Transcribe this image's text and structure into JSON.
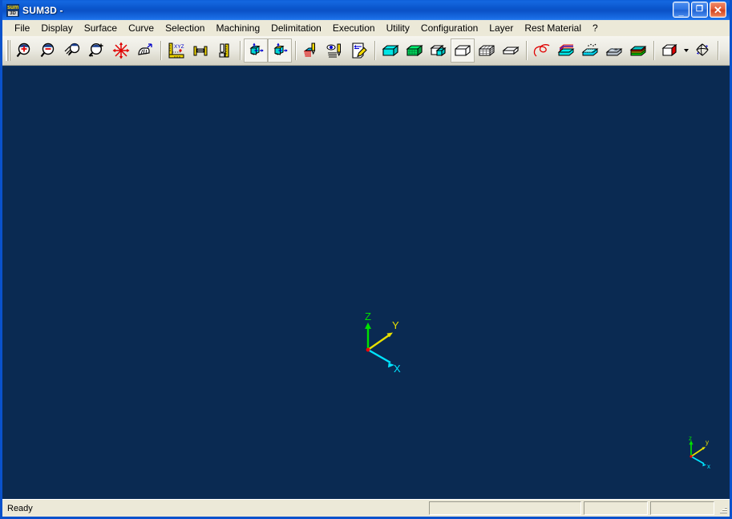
{
  "window": {
    "title": "SUM3D  -",
    "app_icon_top": "sum",
    "app_icon_bottom": "3D",
    "icon_name": "sum3d-app-icon",
    "minimize_glyph": "_",
    "maximize_glyph": "❐",
    "close_glyph": "✕"
  },
  "menu": {
    "items": [
      {
        "label": "File"
      },
      {
        "label": "Display"
      },
      {
        "label": "Surface"
      },
      {
        "label": "Curve"
      },
      {
        "label": "Selection"
      },
      {
        "label": "Machining"
      },
      {
        "label": "Delimitation"
      },
      {
        "label": "Execution"
      },
      {
        "label": "Utility"
      },
      {
        "label": "Configuration"
      },
      {
        "label": "Layer"
      },
      {
        "label": "Rest Material"
      },
      {
        "label": "?"
      }
    ]
  },
  "toolbar": {
    "buttons": [
      {
        "name": "zoom-in-icon",
        "kind": "sep-before"
      },
      {
        "name": "zoom-out-icon"
      },
      {
        "name": "zoom-dynamic-icon"
      },
      {
        "name": "zoom-window-icon"
      },
      {
        "name": "zoom-all-icon"
      },
      {
        "name": "pan-icon"
      },
      {
        "name": "measure-xyz-icon"
      },
      {
        "name": "measure-distance-icon"
      },
      {
        "name": "measure-tool-icon"
      },
      {
        "name": "view-cube-move-icon"
      },
      {
        "name": "view-cube-top-move-icon"
      },
      {
        "name": "toolpath-layers-icon"
      },
      {
        "name": "toolpath-preview-icon"
      },
      {
        "name": "annotate-icon"
      },
      {
        "name": "shade-solid-icon"
      },
      {
        "name": "shade-mesh-icon"
      },
      {
        "name": "shade-partial-icon"
      },
      {
        "name": "wireframe-icon"
      },
      {
        "name": "wireframe-grid-icon"
      },
      {
        "name": "outline-icon"
      },
      {
        "name": "curve-icon"
      },
      {
        "name": "surface-stack-icon"
      },
      {
        "name": "surface-hatch-icon"
      },
      {
        "name": "stock-icon"
      },
      {
        "name": "stock-colored-icon"
      },
      {
        "name": "view-orient-cube-icon"
      },
      {
        "name": "rotate-view-icon"
      }
    ]
  },
  "viewport": {
    "background_color": "#0a2a52",
    "axis_main": {
      "name": "axis-triad-main",
      "labels": {
        "x": "X",
        "y": "Y",
        "z": "Z"
      },
      "colors": {
        "x": "#00e5ff",
        "y": "#e8e000",
        "z": "#00e000",
        "origin": "#ff0000"
      }
    },
    "axis_corner": {
      "name": "axis-triad-corner",
      "labels": {
        "x": "x",
        "y": "y",
        "z": "z"
      },
      "colors": {
        "x": "#00e5ff",
        "y": "#e8e000",
        "z": "#00e000",
        "origin": "#ff0000"
      }
    }
  },
  "statusbar": {
    "message": "Ready",
    "pane1": "",
    "pane2": "",
    "pane3": ""
  }
}
